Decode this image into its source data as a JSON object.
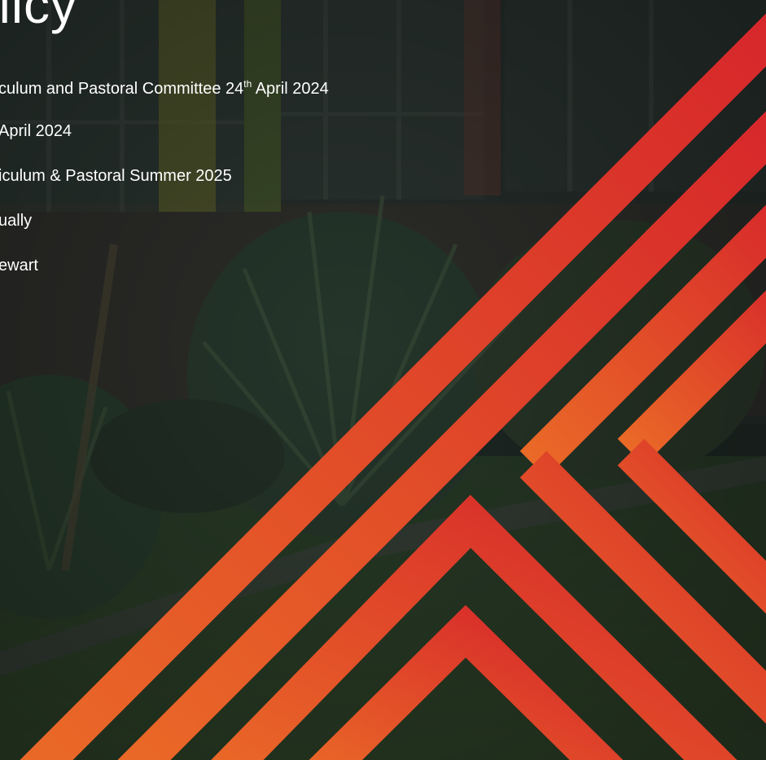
{
  "title": {
    "visible_text": "olicy"
  },
  "details": [
    {
      "before": "culum and Pastoral Committee 24",
      "superscript": "th",
      "after": " April 2024"
    },
    {
      "before": "April 2024",
      "superscript": "",
      "after": ""
    },
    {
      "before": "iculum & Pastoral Summer 2025",
      "superscript": "",
      "after": ""
    },
    {
      "before": "ually",
      "superscript": "",
      "after": ""
    },
    {
      "before": "ewart",
      "superscript": "",
      "after": ""
    }
  ],
  "colors": {
    "stripe_light": "#e8612a",
    "stripe_dark": "#d8232a",
    "overlay": "#1b2420",
    "text": "#ffffff"
  },
  "graphic": {
    "background": "school-building-garden-photo",
    "decoration": "diagonal-chevron-stripes"
  }
}
